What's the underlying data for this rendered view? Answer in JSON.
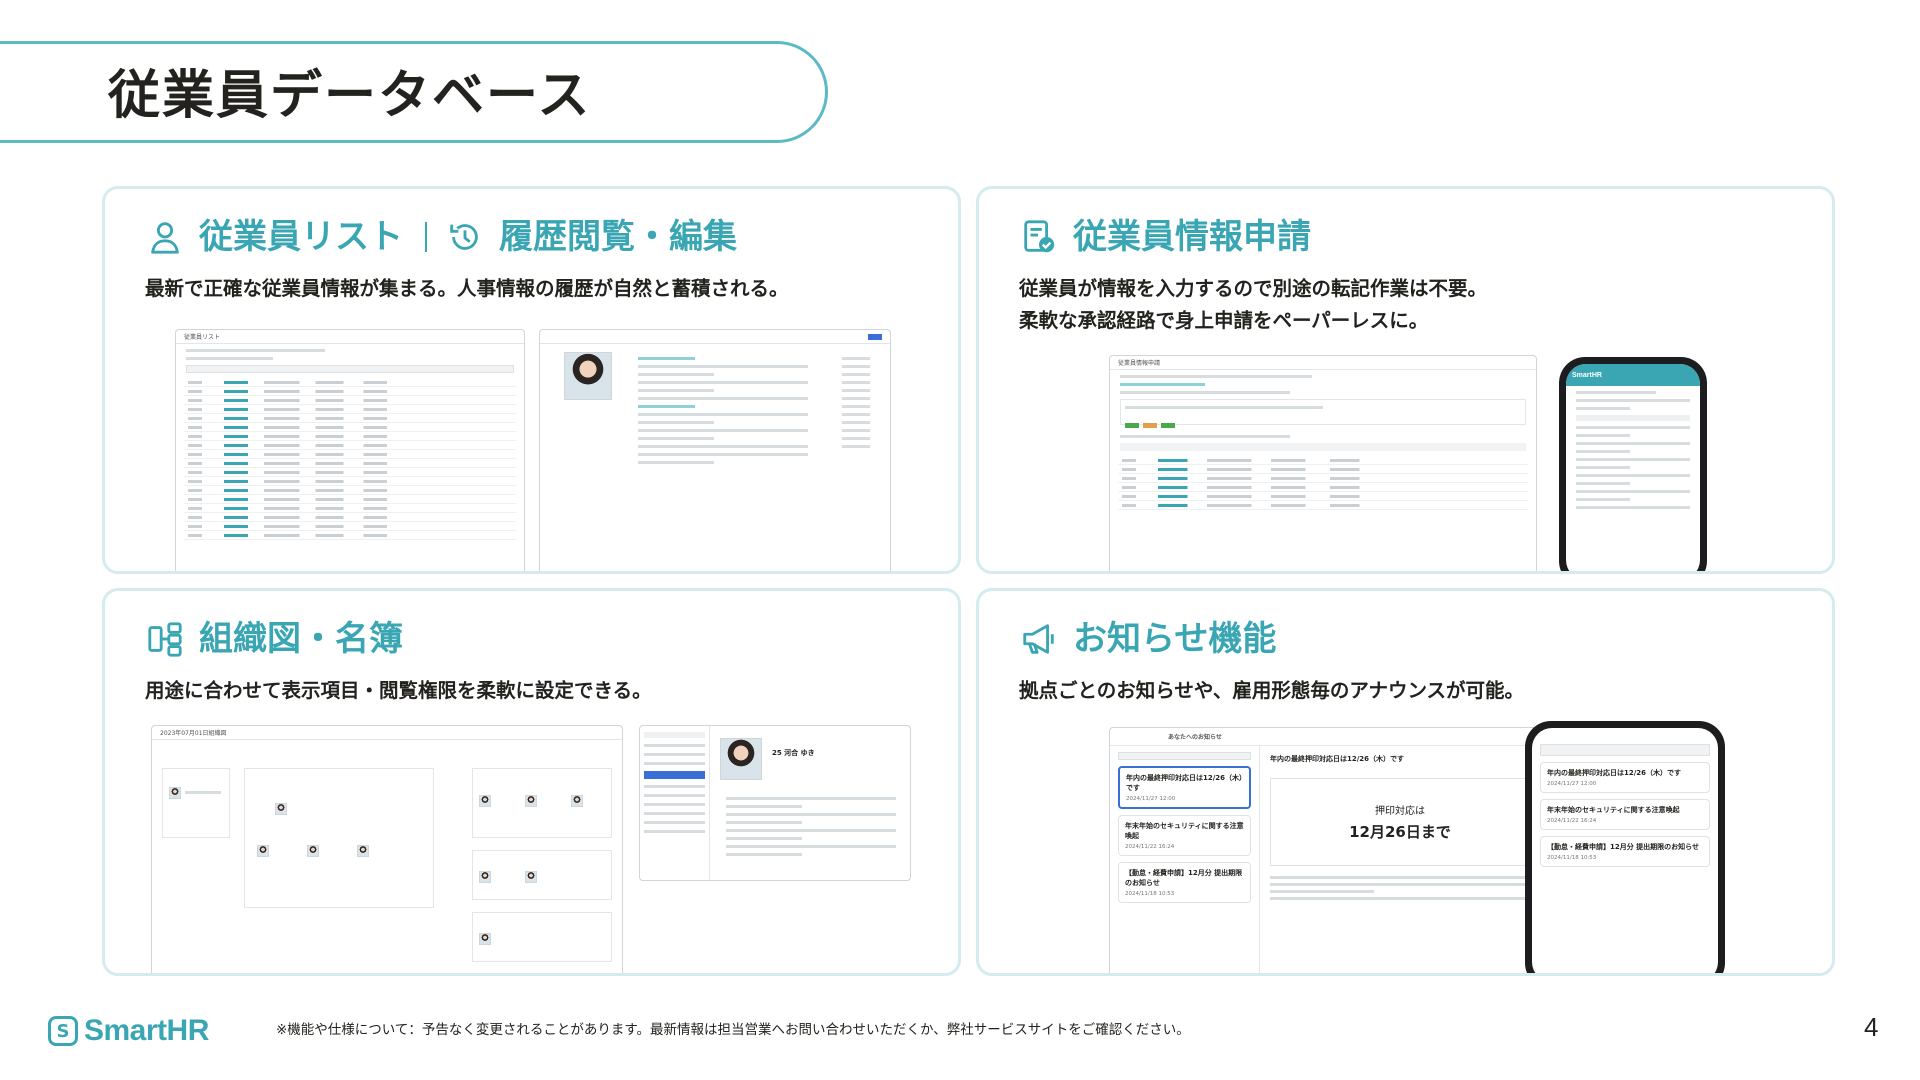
{
  "header": {
    "title": "従業員データベース"
  },
  "cards": [
    {
      "icon": "person-icon",
      "title": "従業員リスト",
      "icon2": "history-icon",
      "title2": "履歴閲覧・編集",
      "description": "最新で正確な従業員情報が集まる。人事情報の履歴が自然と蓄積される。",
      "screen_label": "従業員リスト"
    },
    {
      "icon": "document-check-icon",
      "title": "従業員情報申請",
      "description_lines": [
        "従業員が情報を入力するので別途の転記作業は不要。",
        "柔軟な承認経路で身上申請をペーパーレスに。"
      ],
      "screen_label": "従業員情報申請",
      "phone_label": "SmartHR"
    },
    {
      "icon": "org-chart-icon",
      "title": "組織図・名簿",
      "description": "用途に合わせて表示項目・閲覧権限を柔軟に設定できる。",
      "screen_label": "2023年07月01日組織図",
      "profile_name": "25 河合 ゆき"
    },
    {
      "icon": "megaphone-icon",
      "title": "お知らせ機能",
      "description": "拠点ごとのお知らせや、雇用形態毎のアナウンスが可能。",
      "tab_label": "あなたへのお知らせ",
      "notice_title": "年内の最終押印対応日は12/26（木）です",
      "notice_box_label": "押印対応は",
      "notice_box_date": "12月26日まで",
      "news": [
        {
          "title": "年内の最終押印対応日は12/26（木）です",
          "meta": "2024/11/27 12:00"
        },
        {
          "title": "年末年始のセキュリティに関する注意喚起",
          "meta": "2024/11/22 16:24"
        },
        {
          "title": "【勤怠・経費申請】12月分 提出期限のお知らせ",
          "meta": "2024/11/18 10:53"
        }
      ]
    }
  ],
  "footer": {
    "logo_text": "SmartHR",
    "logo_mark": "S",
    "note": "※機能や仕様について：予告なく変更されることがあります。最新情報は担当営業へお問い合わせいただくか、弊社サービスサイトをご確認ください。",
    "page_number": "4"
  },
  "colors": {
    "accent": "#3aa6b4",
    "card_border": "#d4ebef",
    "text": "#23221e"
  }
}
